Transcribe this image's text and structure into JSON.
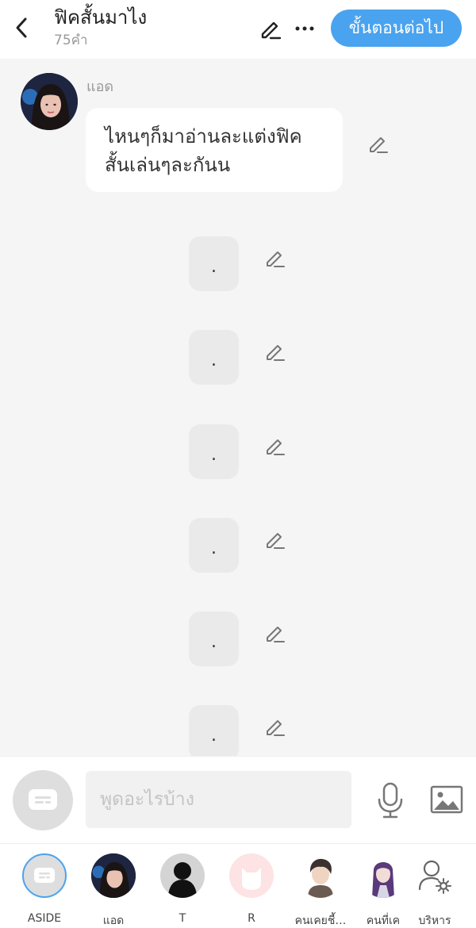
{
  "header": {
    "title": "ฟิคสั้นมาไง",
    "word_count": "75คำ",
    "next_button": "ขั้นตอนต่อไป"
  },
  "chat": {
    "sender_name": "แอด",
    "first_message": "ไหนๆก็มาอ่านละแต่งฟิคสั้นเล่นๆละกันน",
    "dot_messages": [
      ".",
      ".",
      ".",
      ".",
      ".",
      "."
    ]
  },
  "input": {
    "placeholder": "พูดอะไรบ้าง"
  },
  "characters": [
    {
      "label": "ASIDE",
      "avatar": "aside-icon"
    },
    {
      "label": "แอด",
      "avatar": "girl-avatar"
    },
    {
      "label": "T",
      "avatar": "silhouette-avatar"
    },
    {
      "label": "R",
      "avatar": "cat-avatar"
    },
    {
      "label": "คนเคยชี้…",
      "avatar": "boy-avatar"
    },
    {
      "label": "คนที่เค",
      "avatar": "purple-hair-avatar"
    },
    {
      "label": "บริหาร",
      "avatar": "person-gear-icon"
    }
  ],
  "colors": {
    "accent": "#4aa3ee",
    "background": "#f5f5f5",
    "bubble": "#ffffff",
    "dot_bubble": "#eaeaea"
  }
}
